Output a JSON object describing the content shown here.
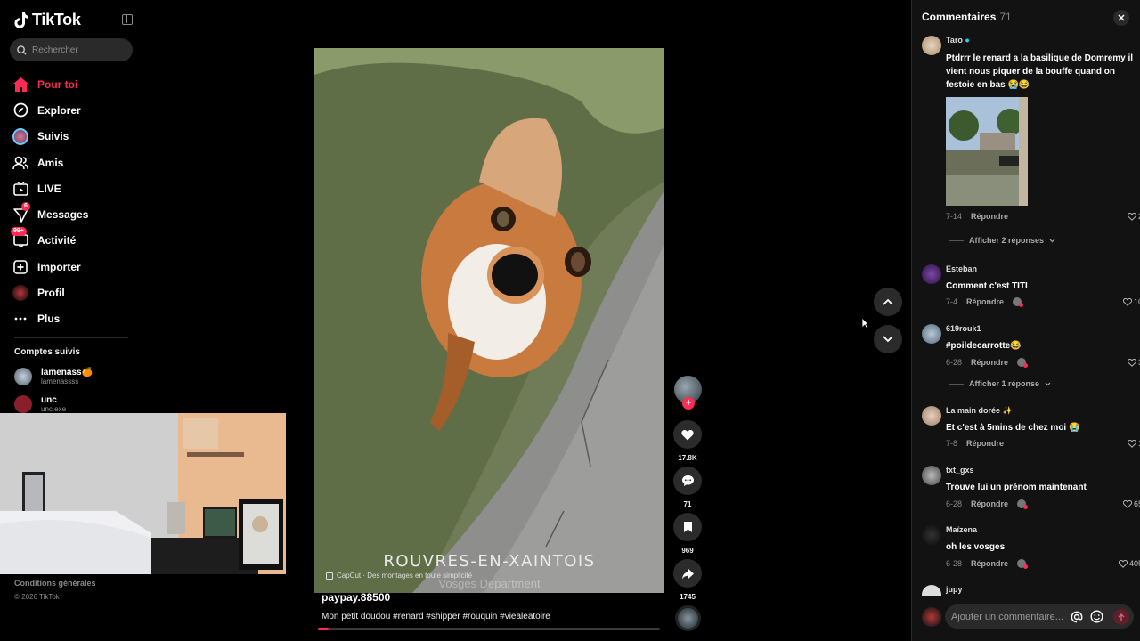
{
  "app": {
    "name": "TikTok"
  },
  "search": {
    "placeholder": "Rechercher"
  },
  "nav": [
    {
      "label": "Pour toi",
      "icon": "home-icon",
      "active": true
    },
    {
      "label": "Explorer",
      "icon": "compass-icon"
    },
    {
      "label": "Suivis",
      "icon": "following-avatar-icon"
    },
    {
      "label": "Amis",
      "icon": "friends-icon"
    },
    {
      "label": "LIVE",
      "icon": "live-icon"
    },
    {
      "label": "Messages",
      "icon": "messages-icon",
      "badge": "6"
    },
    {
      "label": "Activité",
      "icon": "activity-icon",
      "badge": "99+"
    },
    {
      "label": "Importer",
      "icon": "upload-icon"
    },
    {
      "label": "Profil",
      "icon": "profile-avatar-icon"
    },
    {
      "label": "Plus",
      "icon": "more-dots-icon"
    }
  ],
  "followed": {
    "title": "Comptes suivis",
    "accounts": [
      {
        "name": "lamenass🍊",
        "handle": "lamenassss"
      },
      {
        "name": "unc",
        "handle": "unc.exe"
      }
    ]
  },
  "footer": {
    "terms": "Conditions générales",
    "copyright": "© 2026 TikTok"
  },
  "video": {
    "location_overlay": "ROUVRES-EN-XAINTOIS",
    "location_sub": "Vosges Department",
    "capcut": "CapCut · Des montages en toute simplicité",
    "author": "paypay.88500",
    "description": "Mon petit doudou #renard #shipper #rouquin #viealeatoire",
    "progress": 0.03
  },
  "actions": {
    "likes": "17.8K",
    "comments": "71",
    "saves": "969",
    "shares": "1745"
  },
  "comments_panel": {
    "title": "Commentaires",
    "count": "71",
    "input_placeholder": "Ajouter un commentaire...",
    "reply_label": "Répondre",
    "items": [
      {
        "user": "Taro",
        "verified": true,
        "text": "Ptdrrr le renard a la basilique de Domremy il vient nous piquer de la bouffe quand on festoie en bas 😭😂",
        "date": "7-14",
        "likes": "2",
        "more": "Afficher 2 réponses",
        "avatar_color": "#d9c3a6"
      },
      {
        "user": "Esteban",
        "text": "Comment c'est TITI",
        "date": "7-4",
        "likes": "10",
        "avatar_color": "#4a2a6a"
      },
      {
        "user": "619rouk1",
        "text": "#poildecarrotte😂",
        "date": "6-28",
        "likes": "3",
        "more": "Afficher 1 réponse",
        "avatar_color": "#8aa0b5"
      },
      {
        "user": "La main dorée ✨",
        "text": "Et c'est à 5mins de chez moi 😭",
        "date": "7-8",
        "likes": "1",
        "avatar_color": "#c8a88a"
      },
      {
        "user": "txt_gxs",
        "text": "Trouve lui un prénom maintenant",
        "date": "6-28",
        "likes": "65",
        "avatar_color": "#888"
      },
      {
        "user": "Maïzena",
        "text": "oh les vosges",
        "date": "6-28",
        "likes": "405",
        "avatar_color": "#1c1c1c"
      },
      {
        "user": "jupy",
        "avatar_color": "#ddd"
      }
    ]
  }
}
